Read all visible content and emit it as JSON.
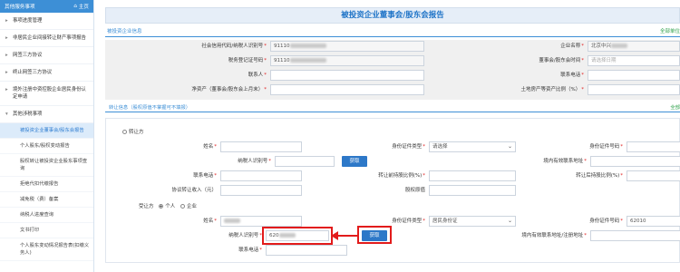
{
  "sidebar": {
    "header": "其他服务事项",
    "home": "主页",
    "items": [
      {
        "label": "事项进度管理",
        "arrow": "▸"
      },
      {
        "label": "非居民企业间接转让财产事项报告",
        "arrow": "▸"
      },
      {
        "label": "网签三方协议",
        "arrow": "▸"
      },
      {
        "label": "终止网签三方协议",
        "arrow": "▸"
      },
      {
        "label": "境外注册中资控股企业居民身份认定申请",
        "arrow": "▸"
      },
      {
        "label": "其他涉税事项",
        "arrow": "▾"
      }
    ],
    "subitems": [
      {
        "label": "被投资企业董事会/股东会报告"
      },
      {
        "label": "个人股东/股权变动报告"
      },
      {
        "label": "股权转让被投资企业股东事项查询"
      },
      {
        "label": "拒绝代扣代缴报告"
      },
      {
        "label": "减免税（费）备案"
      },
      {
        "label": "纳税人进度查询"
      },
      {
        "label": "文书打印"
      },
      {
        "label": "个人股东变动情况报告表(扣缴义务人)"
      }
    ]
  },
  "page": {
    "title": "被投资企业董事会/股东会报告",
    "tab": "被投资企业信息",
    "required_note": "全部单位",
    "section2": "转让信息（股权原值不掌握可不填报）",
    "section2_note": "全部"
  },
  "company": {
    "uscc_label": "社会信用代码/纳税人识别号",
    "uscc_value": "91110",
    "company_label": "企业名称",
    "company_value": "北京中兴",
    "taxreg_label": "税务登记证号码",
    "taxreg_value": "91110",
    "meeting_time_label": "董事会/股东会时间",
    "meeting_time_placeholder": "请选择日期",
    "contact_label": "联系人",
    "phone_label": "联系电话",
    "net_assets_label": "净资产（董事会/股东会上月末）",
    "land_ratio_label": "土地房产等资产比例（%）"
  },
  "transferor": {
    "type_label": "转让方",
    "name_label": "姓名",
    "idtype_label": "身份证件类型",
    "idtype_value": "请选择",
    "idno_label": "身份证件号码",
    "taxid_label": "纳税人识别号",
    "fetch_label": "获取",
    "contact_addr_label": "境内有效联系地址",
    "phone_label": "联系电话",
    "before_ratio_label": "转让前持股比例(%)",
    "after_ratio_label": "转让后持股比例(%)",
    "income_label": "协议转让收入（元）",
    "original_value_label": "股权原值"
  },
  "transferee": {
    "type_label": "受让方",
    "opt_person": "个人",
    "opt_company": "企业",
    "name_label": "姓名",
    "idtype_label": "身份证件类型",
    "idtype_value": "居民身份证",
    "idno_label": "身份证件号码",
    "idno_value": "62010",
    "taxid_label": "纳税人识别号",
    "taxid_value": "620",
    "fetch_label": "获取",
    "contact_addr_label": "境内有效联系地址/注册地址",
    "phone_label": "联系电话"
  },
  "colors": {
    "accent": "#3d8fd6",
    "button": "#2d78c8",
    "highlight": "#e21b1b",
    "required": "#e02020"
  }
}
